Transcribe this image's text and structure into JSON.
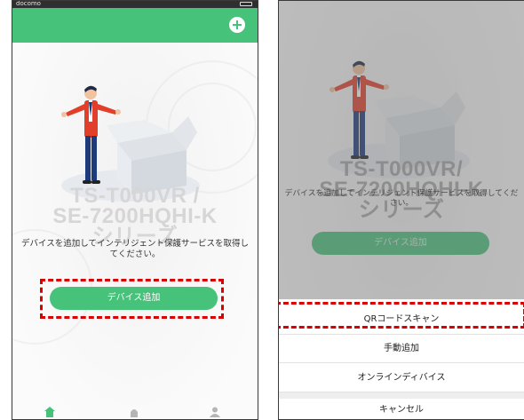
{
  "left_screen": {
    "status_bar": {
      "carrier": "docomo"
    },
    "model_name": "TS-T000VR /\nSE-7200HQHI-K\nシリーズ",
    "info_text": "デバイスを追加してインテリジェント保護サービスを取得してください。",
    "add_device_button": "デバイス追加",
    "icons": [
      "add-icon",
      "home-icon",
      "device-icon",
      "person-icon"
    ]
  },
  "right_screen": {
    "model_name": "TS-T000VR/\nSE-7200HQHI-K\nシリーズ",
    "info_text": "デバイスを追加してインテリジェント保護サービスを取得してください。",
    "add_device_button": "デバイス追加",
    "action_sheet": {
      "qr_scan": "QRコードスキャン",
      "manual_add": "手動追加",
      "online_devices": "オンラインディバイス",
      "cancel": "キャンセル"
    }
  },
  "colors": {
    "accent_green": "#47c27a",
    "highlight_red": "#d80000",
    "watermark_gray": "#d6d6d6"
  }
}
